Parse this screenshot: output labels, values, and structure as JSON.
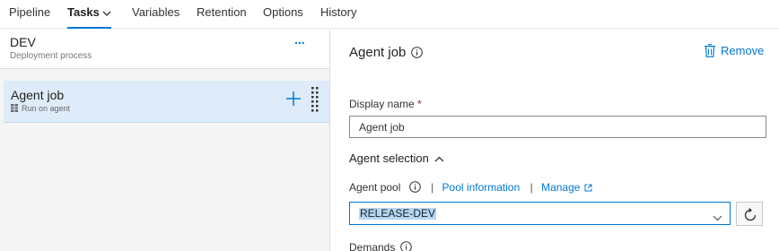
{
  "tabs": [
    {
      "label": "Pipeline"
    },
    {
      "label": "Tasks"
    },
    {
      "label": "Variables"
    },
    {
      "label": "Retention"
    },
    {
      "label": "Options"
    },
    {
      "label": "History"
    }
  ],
  "active_tab": "Tasks",
  "left": {
    "stage_name": "DEV",
    "stage_subtitle": "Deployment process",
    "more_label": "...",
    "job": {
      "title": "Agent job",
      "subtitle": "Run on agent"
    }
  },
  "right": {
    "title": "Agent job",
    "remove_label": "Remove",
    "display_name_label": "Display name",
    "required_mark": "*",
    "display_name_value": "Agent job",
    "agent_selection_label": "Agent selection",
    "agent_pool_label": "Agent pool",
    "separator": "|",
    "pool_info_link": "Pool information",
    "manage_link": "Manage",
    "agent_pool_value": "RELEASE-DEV",
    "demands_label": "Demands"
  },
  "colors": {
    "accent": "#0078d4",
    "selected_row": "#deecf9",
    "required": "#a4262c"
  }
}
